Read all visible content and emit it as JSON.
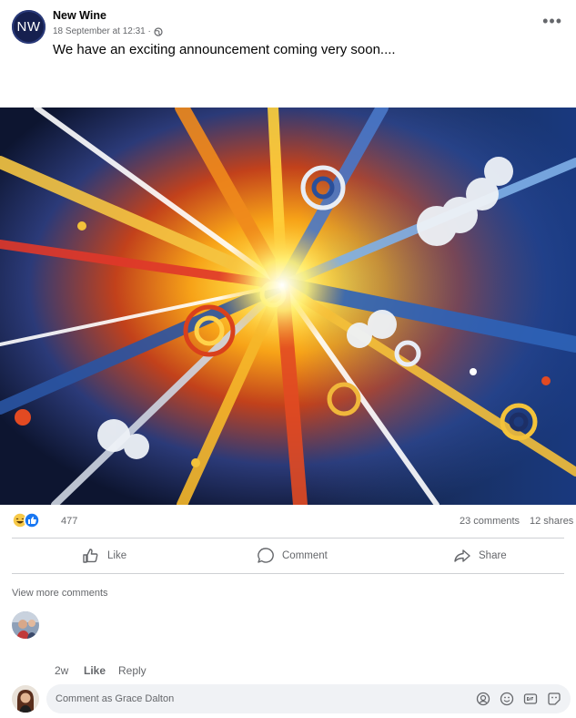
{
  "post": {
    "author": "New Wine",
    "avatar_initials": "NW",
    "timestamp": "18 September at 12:31 ·",
    "privacy_icon": "globe-icon",
    "text": "We have an exciting announcement coming very soon....",
    "more_icon": "more-options-icon",
    "more_label": "•••"
  },
  "stats": {
    "reaction_icons": [
      "haha-icon",
      "like-icon"
    ],
    "reactions": "477",
    "comments": "23 comments",
    "shares": "12 shares"
  },
  "actions": {
    "like": "Like",
    "comment": "Comment",
    "share": "Share"
  },
  "comments": {
    "view_more": "View more comments",
    "first_comment": {
      "age": "2w",
      "like": "Like",
      "reply": "Reply"
    }
  },
  "composer": {
    "placeholder": "Comment as Grace Dalton",
    "icons": [
      "avatar-sticker-icon",
      "emoji-icon",
      "gif-icon",
      "sticker-icon"
    ]
  },
  "colors": {
    "accent": "#1877f2",
    "secondary_text": "#65676b",
    "composer_bg": "#f0f2f5"
  }
}
